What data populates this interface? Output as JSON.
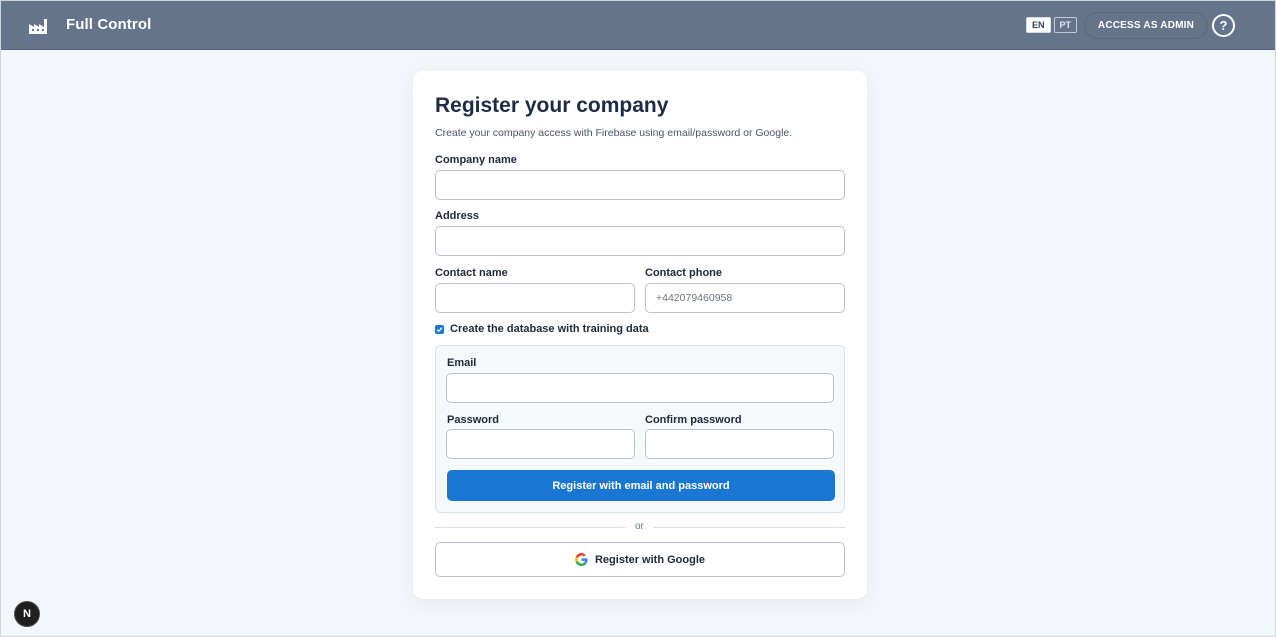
{
  "header": {
    "brand_icon": "factory-icon",
    "title": "Full Control",
    "languages": [
      {
        "code": "EN",
        "active": true
      },
      {
        "code": "PT",
        "active": false
      }
    ],
    "admin_button": "ACCESS AS ADMIN",
    "help_label": "?"
  },
  "form": {
    "title": "Register your company",
    "subtitle": "Create your company access with Firebase using email/password or Google.",
    "company_name_label": "Company name",
    "company_name_value": "",
    "address_label": "Address",
    "address_value": "",
    "contact_name_label": "Contact name",
    "contact_name_value": "",
    "contact_phone_label": "Contact phone",
    "contact_phone_placeholder": "+442079460958",
    "training_data_label": "Create the database with training data",
    "training_data_checked": true,
    "email_label": "Email",
    "email_value": "",
    "password_label": "Password",
    "password_value": "",
    "confirm_password_label": "Confirm password",
    "confirm_password_value": "",
    "register_email_button": "Register with email and password",
    "divider_text": "or",
    "google_button": "Register with Google",
    "google_icon": "google-icon"
  },
  "dev_badge": {
    "label": "N",
    "icon": "nextjs-icon"
  },
  "colors": {
    "header_bg": "#64748b",
    "primary": "#1976d2",
    "page_bg": "#f3f6fb"
  }
}
